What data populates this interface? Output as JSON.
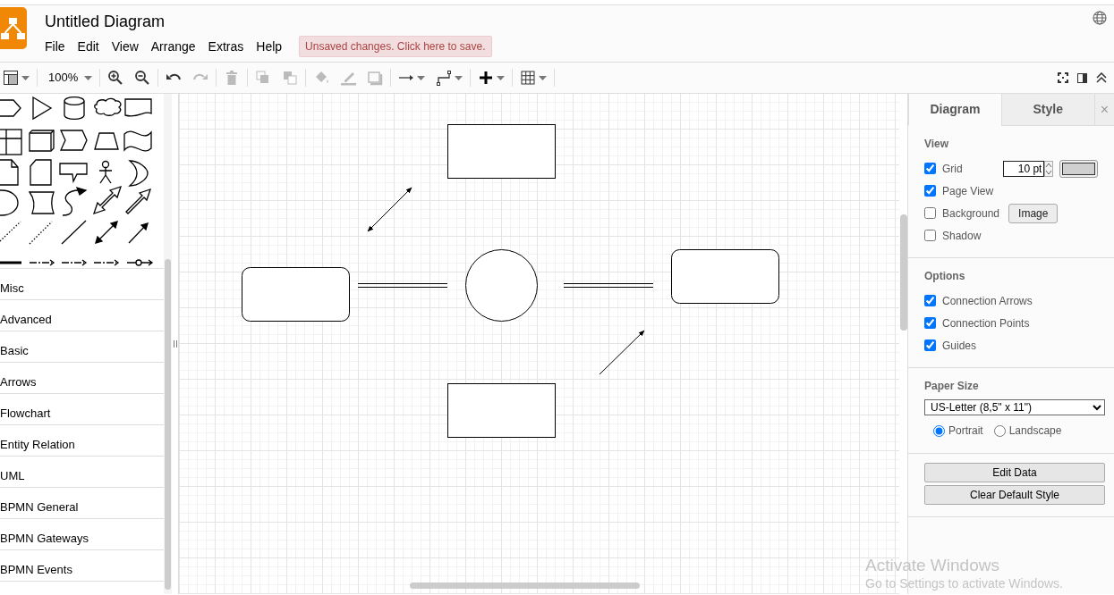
{
  "app": {
    "title": "Untitled Diagram",
    "menu": [
      "File",
      "Edit",
      "View",
      "Arrange",
      "Extras",
      "Help"
    ],
    "notice": "Unsaved changes. Click here to save."
  },
  "toolbar": [
    [
      {
        "kind": "layout",
        "disabled": false,
        "dropdown": true
      }
    ],
    [
      {
        "kind": "zoom",
        "label": "100%",
        "disabled": false,
        "dropdown": true
      }
    ],
    [
      {
        "kind": "zoom-in",
        "disabled": false,
        "dropdown": false
      },
      {
        "kind": "zoom-out",
        "disabled": false,
        "dropdown": false
      }
    ],
    [
      {
        "kind": "undo",
        "disabled": false,
        "dropdown": false
      },
      {
        "kind": "redo",
        "disabled": true,
        "dropdown": false
      }
    ],
    [
      {
        "kind": "delete",
        "disabled": true,
        "dropdown": false
      }
    ],
    [
      {
        "kind": "to-front",
        "disabled": true,
        "dropdown": false
      },
      {
        "kind": "to-back",
        "disabled": true,
        "dropdown": false
      }
    ],
    [
      {
        "kind": "fill",
        "disabled": true,
        "dropdown": false
      },
      {
        "kind": "line",
        "disabled": true,
        "dropdown": false
      },
      {
        "kind": "shadow",
        "disabled": true,
        "dropdown": false
      }
    ],
    [
      {
        "kind": "connection",
        "disabled": false,
        "dropdown": true
      },
      {
        "kind": "waypoint",
        "disabled": false,
        "dropdown": true
      }
    ],
    [
      {
        "kind": "insert",
        "disabled": false,
        "dropdown": true
      }
    ],
    [
      {
        "kind": "table",
        "disabled": false,
        "dropdown": true
      }
    ]
  ],
  "sidebar": {
    "categories": [
      "Misc",
      "Advanced",
      "Basic",
      "Arrows",
      "Flowchart",
      "Entity Relation",
      "UML",
      "BPMN General",
      "BPMN Gateways",
      "BPMN Events"
    ]
  },
  "format_panel": {
    "tabs": [
      {
        "label": "Diagram",
        "selected": true
      },
      {
        "label": "Style",
        "selected": false
      }
    ],
    "close": "×",
    "view": {
      "heading": "View",
      "options": [
        {
          "kind": "grid",
          "label": "Grid",
          "checked": true,
          "value": "10 pt"
        },
        {
          "kind": "plain",
          "label": "Page View",
          "checked": true
        },
        {
          "kind": "background",
          "label": "Background",
          "checked": false,
          "button": "Image"
        },
        {
          "kind": "plain",
          "label": "Shadow",
          "checked": false
        }
      ]
    },
    "options": {
      "heading": "Options",
      "items": [
        {
          "label": "Connection Arrows",
          "checked": true
        },
        {
          "label": "Connection Points",
          "checked": true
        },
        {
          "label": "Guides",
          "checked": true
        }
      ]
    },
    "paper": {
      "heading": "Paper Size",
      "size": "US-Letter (8,5\" x 11\")",
      "orientations": [
        {
          "label": "Portrait",
          "selected": true
        },
        {
          "label": "Landscape",
          "selected": false
        }
      ]
    },
    "buttons": [
      "Edit Data",
      "Clear Default Style"
    ]
  },
  "os_notice": {
    "title": "Activate Windows",
    "text": "Go to Settings to activate Windows."
  }
}
